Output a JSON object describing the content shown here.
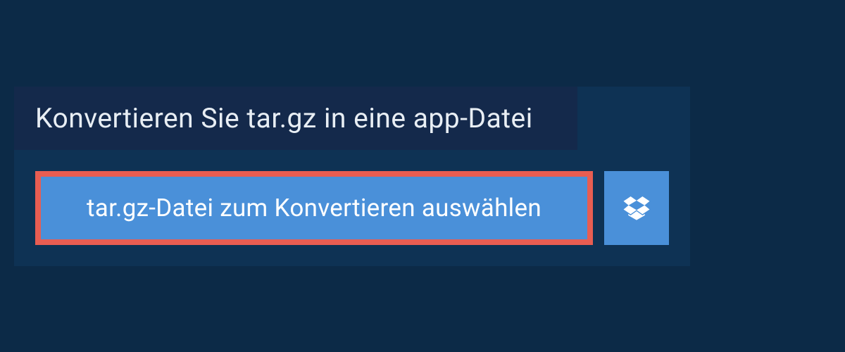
{
  "title": "Konvertieren Sie tar.gz in eine app-Datei",
  "select_button_label": "tar.gz-Datei zum Konvertieren auswählen",
  "colors": {
    "page_bg": "#0c2a47",
    "panel_bg": "#0e3254",
    "title_bar_bg": "#14294b",
    "button_bg": "#4a90d9",
    "highlight_border": "#e85d52",
    "text_light": "#e8eef4",
    "text_white": "#ffffff"
  },
  "icons": {
    "dropbox": "dropbox-icon"
  }
}
